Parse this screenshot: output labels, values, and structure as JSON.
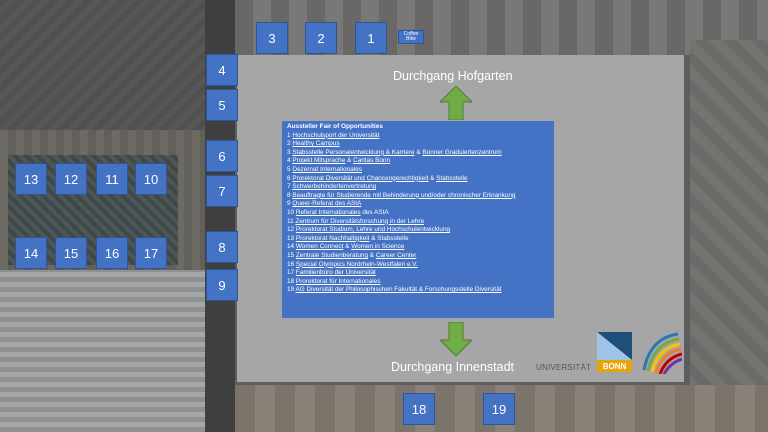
{
  "labels": {
    "hofgarten": "Durchgang Hofgarten",
    "innenstadt": "Durchgang Innenstadt",
    "coffee_bike": "Coffee Bike"
  },
  "stands": [
    "1",
    "2",
    "3",
    "4",
    "5",
    "6",
    "7",
    "8",
    "9",
    "10",
    "11",
    "12",
    "13",
    "14",
    "15",
    "16",
    "17",
    "18",
    "19"
  ],
  "exhibitor_list": {
    "title": "Aussteller Fair of Opportunities",
    "entries": [
      {
        "pre": "1 ",
        "a": "Hochschulsport der Universität",
        "mid": "",
        "b": "",
        "post": ""
      },
      {
        "pre": "2 ",
        "a": "Healthy Campus",
        "mid": "",
        "b": "",
        "post": ""
      },
      {
        "pre": "3 ",
        "a": "Stabsstelle Personalentwicklung & Karriere",
        "mid": " & ",
        "b": "Bonner Graduiertenzentrum",
        "post": ""
      },
      {
        "pre": "4 ",
        "a": "Projekt Mitsprache",
        "mid": " & ",
        "b": "Caritas Bonn",
        "post": ""
      },
      {
        "pre": "5 ",
        "a": "Dezernat Internationales",
        "mid": "",
        "b": "",
        "post": ""
      },
      {
        "pre": "6 ",
        "a": "Prorektorat Diversität und Chancengerechtigkeit",
        "mid": " & ",
        "b": "Stabsstelle",
        "post": ""
      },
      {
        "pre": "7 ",
        "a": "Schwerbehindertenvertretung",
        "mid": "",
        "b": "",
        "post": ""
      },
      {
        "pre": "8 ",
        "a": "Beauftragte für Studierende mit Behinderung und/oder chronischer Erkrankung",
        "mid": "",
        "b": "",
        "post": ""
      },
      {
        "pre": "9 ",
        "a": "Queer-Referat des AStA",
        "mid": "",
        "b": "",
        "post": ""
      },
      {
        "pre": "10 ",
        "a": "Referat Internationales",
        "mid": "",
        "b": "",
        "post": " des AStA"
      },
      {
        "pre": "11 ",
        "a": "Zentrum für Diversitätsforschung in der Lehre",
        "mid": "",
        "b": "",
        "post": ""
      },
      {
        "pre": "12 ",
        "a": "Prorektorat Studium, Lehre und Hochschulentwicklung",
        "mid": "",
        "b": "",
        "post": ""
      },
      {
        "pre": "13 ",
        "a": "Prorektorat Nachhaltigkeit",
        "mid": "",
        "b": "",
        "post": " & Stabsstelle"
      },
      {
        "pre": "14 ",
        "a": "Women Connect",
        "mid": " & ",
        "b": "Women in Science",
        "post": ""
      },
      {
        "pre": "15  ",
        "a": "Zentrale Studienberatung",
        "mid": " & ",
        "b": "Career Center",
        "post": ""
      },
      {
        "pre": "16 ",
        "a": "Special Olympics Nordrhein-Westfalen e.V.",
        "mid": "",
        "b": "",
        "post": ""
      },
      {
        "pre": "17 ",
        "a": "Familienbüro der Universität",
        "mid": "",
        "b": "",
        "post": ""
      },
      {
        "pre": "18 ",
        "a": "Prorektorat für Internationales",
        "mid": "",
        "b": "",
        "post": ""
      },
      {
        "pre": "19 ",
        "a": "AG Diversität der Philosophischen Fakultät & Forschungsstelle Diversität",
        "mid": "",
        "b": "",
        "post": ""
      }
    ]
  },
  "logo": {
    "universitaet": "UNIVERSITÄT",
    "bonn": "BONN"
  },
  "colors": {
    "stand_blue": "#4472c4",
    "arrow_green": "#70ad47",
    "panel_gray": "#a6a6a6",
    "logo_orange": "#e8a20c"
  }
}
